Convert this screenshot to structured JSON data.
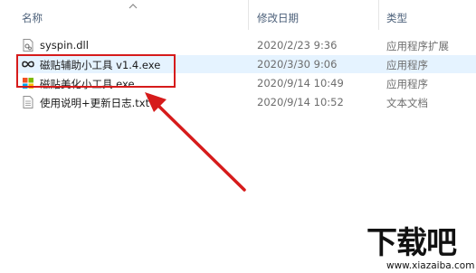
{
  "columns": {
    "name": "名称",
    "modified": "修改日期",
    "type": "类型"
  },
  "files": [
    {
      "name": "syspin.dll",
      "date": "2020/2/23 9:36",
      "type": "应用程序扩展",
      "icon": "dll-file-icon"
    },
    {
      "name": "磁贴辅助小工具 v1.4.exe",
      "date": "2020/3/30 9:06",
      "type": "应用程序",
      "icon": "infinity-app-icon"
    },
    {
      "name": "磁贴美化小工具.exe",
      "date": "2020/9/14 10:49",
      "type": "应用程序",
      "icon": "windows-tiles-app-icon"
    },
    {
      "name": "使用说明+更新日志.txt",
      "date": "2020/9/14 10:52",
      "type": "文本文档",
      "icon": "text-document-icon"
    }
  ],
  "annotation": {
    "color": "#d61b1b"
  },
  "watermark": {
    "logo_text": "下载吧",
    "url": "www.xiazaiba.com"
  }
}
